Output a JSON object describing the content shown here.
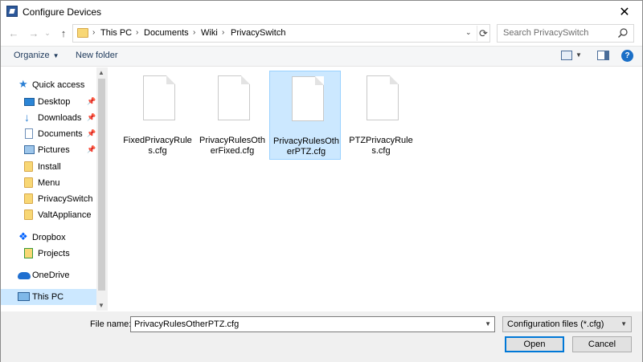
{
  "window": {
    "title": "Configure Devices",
    "close_glyph": "✕"
  },
  "nav": {
    "back_glyph": "←",
    "forward_glyph": "→",
    "dropdown_glyph": "⌄",
    "up_glyph": "↑",
    "refresh_glyph": "⟳"
  },
  "breadcrumbs": [
    "This PC",
    "Documents",
    "Wiki",
    "PrivacySwitch"
  ],
  "crumb_separator": "›",
  "address_dropdown_glyph": "⌄",
  "search": {
    "placeholder": "Search PrivacySwitch"
  },
  "toolbar": {
    "organize_label": "Organize",
    "new_folder_label": "New folder",
    "help_label": "?"
  },
  "sidebar": {
    "items": [
      {
        "label": "Quick access",
        "icon": "star-icon",
        "pinned": false
      },
      {
        "label": "Desktop",
        "icon": "desktop-icon",
        "pinned": true
      },
      {
        "label": "Downloads",
        "icon": "download-icon",
        "pinned": true
      },
      {
        "label": "Documents",
        "icon": "document-icon",
        "pinned": true
      },
      {
        "label": "Pictures",
        "icon": "pictures-icon",
        "pinned": true
      },
      {
        "label": "Install",
        "icon": "folder-icon",
        "pinned": false
      },
      {
        "label": "Menu",
        "icon": "folder-icon",
        "pinned": false
      },
      {
        "label": "PrivacySwitch",
        "icon": "folder-icon",
        "pinned": false
      },
      {
        "label": "ValtAppliance",
        "icon": "folder-icon",
        "pinned": false
      },
      {
        "label": "Dropbox",
        "icon": "dropbox-icon",
        "pinned": false
      },
      {
        "label": "Projects",
        "icon": "projects-icon",
        "pinned": false
      },
      {
        "label": "OneDrive",
        "icon": "onedrive-icon",
        "pinned": false
      },
      {
        "label": "This PC",
        "icon": "computer-icon",
        "pinned": false,
        "selected": true
      }
    ]
  },
  "files": [
    {
      "name": "FixedPrivacyRules.cfg",
      "selected": false
    },
    {
      "name": "PrivacyRulesOtherFixed.cfg",
      "selected": false
    },
    {
      "name": "PrivacyRulesOtherPTZ.cfg",
      "selected": true
    },
    {
      "name": "PTZPrivacyRules.cfg",
      "selected": false
    }
  ],
  "footer": {
    "filename_label": "File name:",
    "filename_value": "PrivacyRulesOtherPTZ.cfg",
    "filter_value": "Configuration files (*.cfg)",
    "open_label": "Open",
    "cancel_label": "Cancel"
  },
  "colors": {
    "selection": "#cce8ff",
    "selection_border": "#99d1ff",
    "accent": "#0078d7",
    "folder": "#f8d775"
  }
}
